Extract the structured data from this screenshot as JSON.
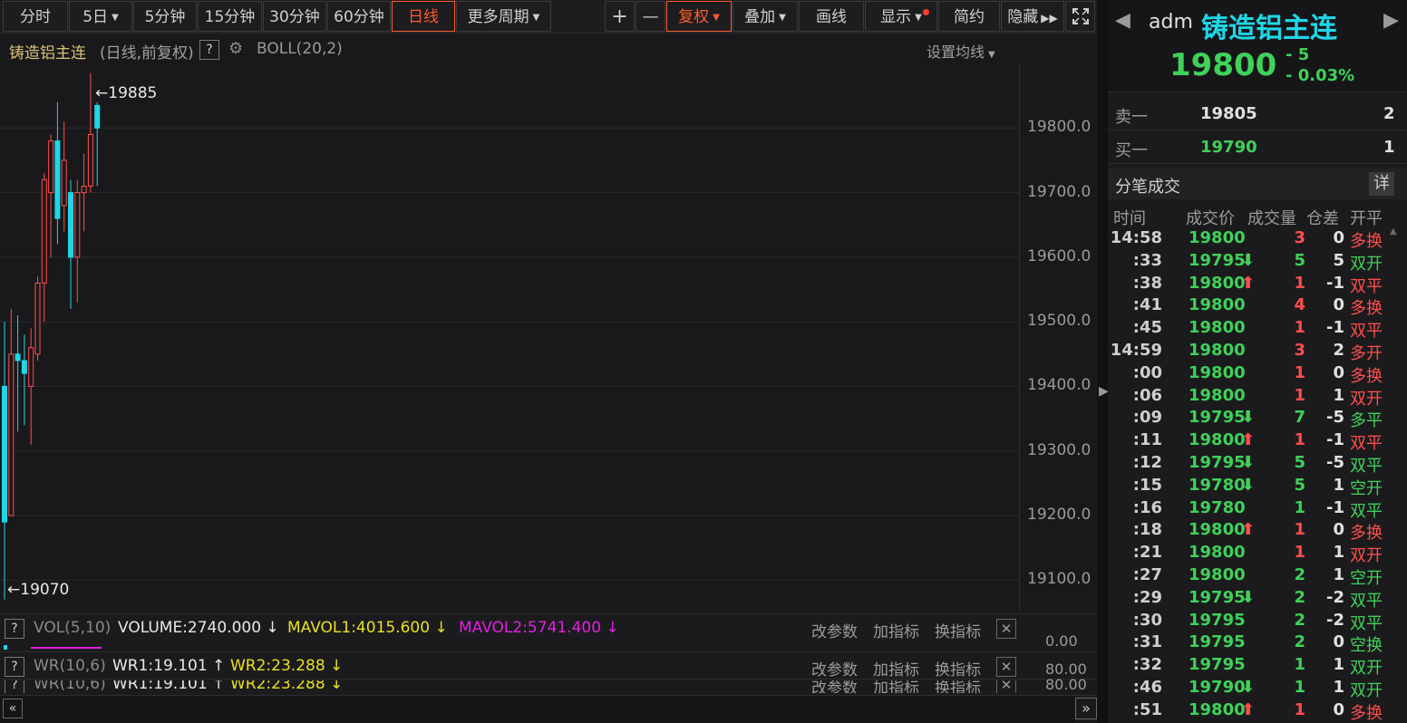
{
  "toolbar": {
    "fenshi": "分时",
    "five_day": "5日",
    "m5": "5分钟",
    "m15": "15分钟",
    "m30": "30分钟",
    "m60": "60分钟",
    "daily": "日线",
    "more_period": "更多周期",
    "plus": "+",
    "minus": "—",
    "fuquan": "复权",
    "overlay": "叠加",
    "draw": "画线",
    "display": "显示",
    "simple": "简约",
    "hide": "隐藏"
  },
  "chart": {
    "title": "铸造铝主连",
    "subtitle": "(日线,前复权)",
    "help": "?",
    "indicator": "BOLL(20,2)",
    "set_ma": "设置均线",
    "high_label": "19885",
    "low_label": "19070",
    "y_ticks": [
      "19800.0",
      "19700.0",
      "19600.0",
      "19500.0",
      "19400.0",
      "19300.0",
      "19200.0",
      "19100.0"
    ]
  },
  "chart_data": {
    "type": "candlestick",
    "y_range": [
      19050,
      19900
    ],
    "up_color": "#ff4d4d",
    "down_color": "#1fd6e6",
    "candles": [
      {
        "o": 19400,
        "h": 19500,
        "l": 19070,
        "c": 19190
      },
      {
        "o": 19200,
        "h": 19520,
        "l": 19200,
        "c": 19450
      },
      {
        "o": 19450,
        "h": 19510,
        "l": 19330,
        "c": 19440
      },
      {
        "o": 19440,
        "h": 19480,
        "l": 19340,
        "c": 19420
      },
      {
        "o": 19400,
        "h": 19490,
        "l": 19310,
        "c": 19460
      },
      {
        "o": 19450,
        "h": 19570,
        "l": 19440,
        "c": 19560
      },
      {
        "o": 19560,
        "h": 19730,
        "l": 19500,
        "c": 19720
      },
      {
        "o": 19700,
        "h": 19790,
        "l": 19600,
        "c": 19780
      },
      {
        "o": 19780,
        "h": 19840,
        "l": 19620,
        "c": 19660
      },
      {
        "o": 19680,
        "h": 19810,
        "l": 19640,
        "c": 19750
      },
      {
        "o": 19700,
        "h": 19720,
        "l": 19520,
        "c": 19600
      },
      {
        "o": 19600,
        "h": 19720,
        "l": 19530,
        "c": 19700
      },
      {
        "o": 19700,
        "h": 19760,
        "l": 19640,
        "c": 19710
      },
      {
        "o": 19710,
        "h": 19885,
        "l": 19700,
        "c": 19790
      },
      {
        "o": 19835,
        "h": 19840,
        "l": 19710,
        "c": 19800
      }
    ]
  },
  "vol": {
    "help": "?",
    "name": "VOL(5,10)",
    "volume": "VOLUME:2740.000",
    "mavol1": "MAVOL1:4015.600",
    "mavol2": "MAVOL2:5741.400",
    "axis": "0.00"
  },
  "wr": {
    "help": "?",
    "name": "WR(10,6)",
    "wr1": "WR1:19.101",
    "wr2": "WR2:23.288",
    "axis": "80.00"
  },
  "wr_dup": {
    "help": "?",
    "name": "WR(10,6)",
    "wr1": "WR1:19.101",
    "wr2": "WR2:23.288",
    "axis": "80.00"
  },
  "panel_buttons": {
    "params": "改参数",
    "add": "加指标",
    "switch": "换指标",
    "close": "✕"
  },
  "quote": {
    "code": "adm",
    "name": "铸造铝主连",
    "price": "19800",
    "change": "- 5",
    "pct": "- 0.03%"
  },
  "book": {
    "sell1_label": "卖一",
    "sell1_price": "19805",
    "sell1_qty": "2",
    "buy1_label": "买一",
    "buy1_price": "19790",
    "buy1_qty": "1"
  },
  "ticks": {
    "title": "分笔成交",
    "detail": "详",
    "headers": [
      "时间",
      "成交价",
      "成交量",
      "仓差",
      "开平"
    ],
    "rows": [
      {
        "time": "14:58",
        "price": "19800",
        "dir": "",
        "vol": "3",
        "vol_color": "red",
        "oi": "0",
        "type": "多换",
        "type_color": "red"
      },
      {
        "time": ":33",
        "price": "19795",
        "dir": "dn",
        "vol": "5",
        "vol_color": "green",
        "oi": "5",
        "type": "双开",
        "type_color": "green"
      },
      {
        "time": ":38",
        "price": "19800",
        "dir": "up",
        "vol": "1",
        "vol_color": "red",
        "oi": "-1",
        "type": "双平",
        "type_color": "red"
      },
      {
        "time": ":41",
        "price": "19800",
        "dir": "",
        "vol": "4",
        "vol_color": "red",
        "oi": "0",
        "type": "多换",
        "type_color": "red"
      },
      {
        "time": ":45",
        "price": "19800",
        "dir": "",
        "vol": "1",
        "vol_color": "red",
        "oi": "-1",
        "type": "双平",
        "type_color": "red"
      },
      {
        "time": "14:59",
        "price": "19800",
        "dir": "",
        "vol": "3",
        "vol_color": "red",
        "oi": "2",
        "type": "多开",
        "type_color": "red"
      },
      {
        "time": ":00",
        "price": "19800",
        "dir": "",
        "vol": "1",
        "vol_color": "red",
        "oi": "0",
        "type": "多换",
        "type_color": "red"
      },
      {
        "time": ":06",
        "price": "19800",
        "dir": "",
        "vol": "1",
        "vol_color": "red",
        "oi": "1",
        "type": "双开",
        "type_color": "red"
      },
      {
        "time": ":09",
        "price": "19795",
        "dir": "dn",
        "vol": "7",
        "vol_color": "green",
        "oi": "-5",
        "type": "多平",
        "type_color": "green"
      },
      {
        "time": ":11",
        "price": "19800",
        "dir": "up",
        "vol": "1",
        "vol_color": "red",
        "oi": "-1",
        "type": "双平",
        "type_color": "red"
      },
      {
        "time": ":12",
        "price": "19795",
        "dir": "dn",
        "vol": "5",
        "vol_color": "green",
        "oi": "-5",
        "type": "双平",
        "type_color": "green"
      },
      {
        "time": ":15",
        "price": "19780",
        "dir": "dn",
        "vol": "5",
        "vol_color": "green",
        "oi": "1",
        "type": "空开",
        "type_color": "green"
      },
      {
        "time": ":16",
        "price": "19780",
        "dir": "",
        "vol": "1",
        "vol_color": "green",
        "oi": "-1",
        "type": "双平",
        "type_color": "green"
      },
      {
        "time": ":18",
        "price": "19800",
        "dir": "up",
        "vol": "1",
        "vol_color": "red",
        "oi": "0",
        "type": "多换",
        "type_color": "red"
      },
      {
        "time": ":21",
        "price": "19800",
        "dir": "",
        "vol": "1",
        "vol_color": "red",
        "oi": "1",
        "type": "双开",
        "type_color": "red"
      },
      {
        "time": ":27",
        "price": "19800",
        "dir": "",
        "vol": "2",
        "vol_color": "green",
        "oi": "1",
        "type": "空开",
        "type_color": "green"
      },
      {
        "time": ":29",
        "price": "19795",
        "dir": "dn",
        "vol": "2",
        "vol_color": "green",
        "oi": "-2",
        "type": "双平",
        "type_color": "green"
      },
      {
        "time": ":30",
        "price": "19795",
        "dir": "",
        "vol": "2",
        "vol_color": "green",
        "oi": "-2",
        "type": "双平",
        "type_color": "green"
      },
      {
        "time": ":31",
        "price": "19795",
        "dir": "",
        "vol": "2",
        "vol_color": "green",
        "oi": "0",
        "type": "空换",
        "type_color": "green"
      },
      {
        "time": ":32",
        "price": "19795",
        "dir": "",
        "vol": "1",
        "vol_color": "green",
        "oi": "1",
        "type": "双开",
        "type_color": "green"
      },
      {
        "time": ":46",
        "price": "19790",
        "dir": "dn",
        "vol": "1",
        "vol_color": "green",
        "oi": "1",
        "type": "双开",
        "type_color": "green"
      },
      {
        "time": ":51",
        "price": "19800",
        "dir": "up",
        "vol": "1",
        "vol_color": "red",
        "oi": "0",
        "type": "多换",
        "type_color": "red"
      }
    ]
  },
  "icons": {
    "gear": "gear-icon",
    "fullscreen": "fullscreen-icon",
    "prev": "chevron-left-icon",
    "next": "chevron-right-icon"
  }
}
